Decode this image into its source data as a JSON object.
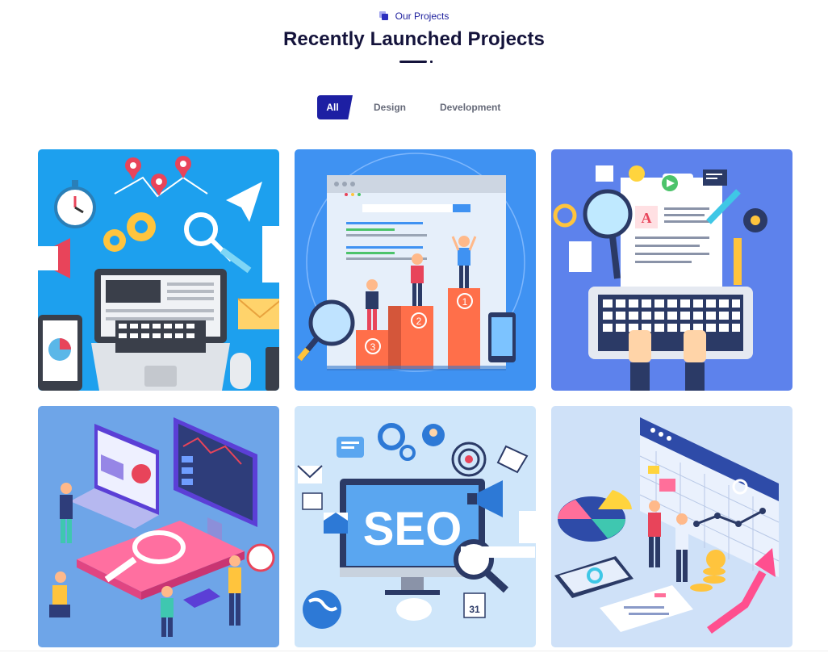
{
  "section": {
    "eyebrow_icon": "stacked-squares-icon",
    "eyebrow": "Our Projects",
    "title": "Recently Launched Projects"
  },
  "filters": {
    "all": "All",
    "design": "Design",
    "development": "Development",
    "active": "All"
  },
  "colors": {
    "accent": "#1d1fa3",
    "title": "#14133b"
  },
  "projects": [
    {
      "illustration": "digital-marketing-laptop-illustration"
    },
    {
      "illustration": "seo-ranking-podium-illustration"
    },
    {
      "illustration": "content-writing-keyboard-illustration"
    },
    {
      "illustration": "isometric-seo-analytics-illustration"
    },
    {
      "illustration": "seo-monitor-illustration"
    },
    {
      "illustration": "business-calendar-charts-illustration"
    }
  ],
  "artwork_text": {
    "podium_numbers": [
      "1",
      "2",
      "3"
    ],
    "seo": "SEO",
    "calendar_day": "31",
    "doc_letter": "A"
  }
}
